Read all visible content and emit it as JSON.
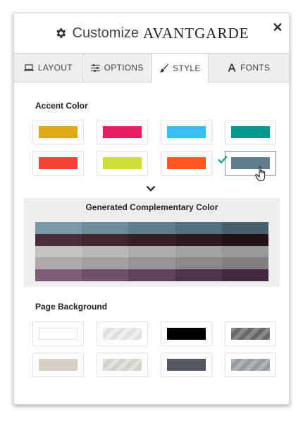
{
  "header": {
    "title_prefix": "Customize",
    "title_brand": "AVANTGARDE",
    "close_glyph": "✕"
  },
  "tabs": [
    {
      "label": "LAYOUT",
      "icon": "laptop-icon",
      "active": false
    },
    {
      "label": "OPTIONS",
      "icon": "sliders-icon",
      "active": false
    },
    {
      "label": "STYLE",
      "icon": "paintbrush-icon",
      "active": true
    },
    {
      "label": "FONTS",
      "icon": "font-a-icon",
      "active": false
    }
  ],
  "accent": {
    "title": "Accent Color",
    "colors": [
      "#dfaa13",
      "#e91d63",
      "#38bdef",
      "#00978c",
      "#f44336",
      "#cde03a",
      "#ff5621",
      "#607e8b"
    ],
    "selected_index": 7,
    "check_color": "#2bab84"
  },
  "complementary": {
    "title": "Generated Complementary Color",
    "rows": [
      [
        "#7a99a6",
        "#6c8c99",
        "#5f7d8a",
        "#52707d",
        "#465f6a"
      ],
      [
        "#4a2c3a",
        "#412530",
        "#381e28",
        "#2e1820",
        "#251218"
      ],
      [
        "#c4c4c2",
        "#b8b8b6",
        "#acacaa",
        "#a2a2a0",
        "#989896"
      ],
      [
        "#ada9ac",
        "#a39fa2",
        "#989497",
        "#8c888b",
        "#827e81"
      ],
      [
        "#7e5c78",
        "#6e4e69",
        "#5e415b",
        "#4f344d",
        "#42293f"
      ]
    ]
  },
  "background": {
    "title": "Page Background",
    "swatches": [
      {
        "color": "#ffffff",
        "pattern": false
      },
      {
        "color": "#ebebeb",
        "pattern": true
      },
      {
        "color": "#000000",
        "pattern": false
      },
      {
        "color": "#6e6e6e",
        "pattern": true
      },
      {
        "color": "#d8d0c4",
        "pattern": false
      },
      {
        "color": "#dcdcd4",
        "pattern": true
      },
      {
        "color": "#535860",
        "pattern": false
      },
      {
        "color": "#9fa2a6",
        "pattern": true
      }
    ]
  }
}
